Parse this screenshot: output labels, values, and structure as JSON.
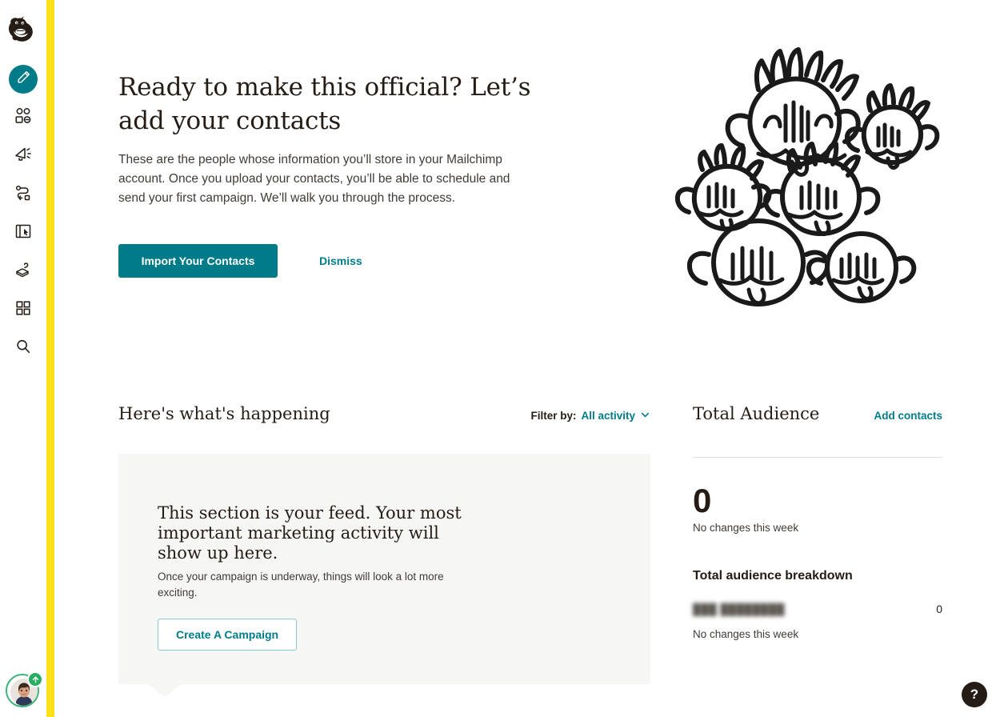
{
  "brand": {
    "logo_icon": "mailchimp-freddie-logo",
    "accent_teal": "#007c89",
    "accent_yellow": "#ffe01b",
    "ink": "#241c15",
    "card_bg": "#f6f6f4"
  },
  "sidebar": {
    "items": [
      {
        "name": "create",
        "icon": "pencil-icon",
        "active": true
      },
      {
        "name": "audience",
        "icon": "audience-people-icon",
        "active": false
      },
      {
        "name": "campaigns",
        "icon": "megaphone-icon",
        "active": false
      },
      {
        "name": "automations",
        "icon": "automation-flow-icon",
        "active": false
      },
      {
        "name": "website",
        "icon": "website-cursor-icon",
        "active": false
      },
      {
        "name": "content-studio",
        "icon": "content-studio-icon",
        "active": false
      },
      {
        "name": "integrations",
        "icon": "grid-squares-icon",
        "active": false
      },
      {
        "name": "search",
        "icon": "search-icon",
        "active": false
      }
    ],
    "avatar": {
      "icon": "user-avatar",
      "badge_icon": "upgrade-arrow-up-icon",
      "ring_color": "#3eb57c",
      "badge_color": "#27ae60"
    }
  },
  "hero": {
    "title": "Ready to make this official? Let’s add your contacts",
    "body": "These are the people whose information you’ll store in your Mailchimp account. Once you upload your contacts, you’ll be able to schedule and send your first campaign. We’ll walk you through the process.",
    "primary_button": "Import Your Contacts",
    "dismiss_link": "Dismiss",
    "illustration": "crowd-of-faces-doodle"
  },
  "feed": {
    "title": "Here's what's happening",
    "filter_label": "Filter by:",
    "filter_value": "All activity",
    "filter_chevron_icon": "chevron-down-icon",
    "card": {
      "title": "This section is your feed. Your most important marketing activity will show up here.",
      "subtitle": "Once your campaign is underway, things will look a lot more exciting.",
      "button": "Create A Campaign"
    }
  },
  "audience": {
    "title": "Total Audience",
    "add_link": "Add contacts",
    "total_count": "0",
    "total_change": "No changes this week",
    "breakdown_title": "Total audience breakdown",
    "rows": [
      {
        "name": "███ ████████",
        "redacted": true,
        "count": "0"
      }
    ],
    "breakdown_change": "No changes this week"
  },
  "help": {
    "label": "?",
    "icon": "question-mark-icon"
  }
}
